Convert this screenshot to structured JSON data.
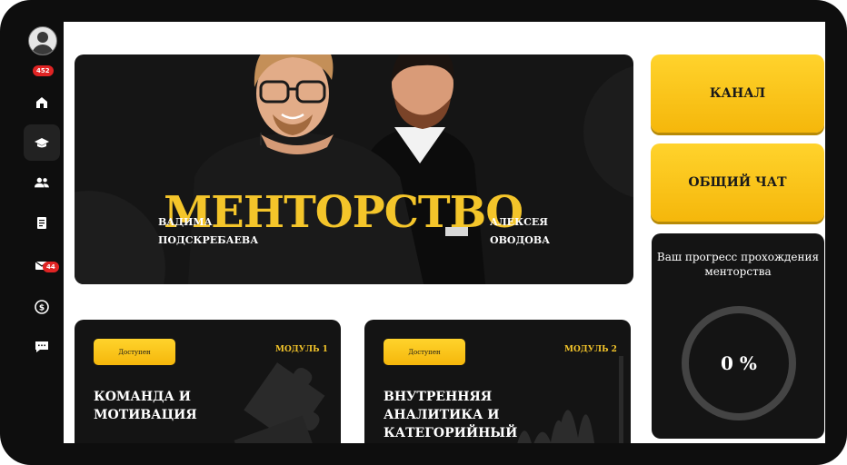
{
  "sidebar": {
    "profile_badge": "452",
    "mail_badge": "44",
    "items": [
      {
        "icon": "home-icon"
      },
      {
        "icon": "graduation-cap-icon"
      },
      {
        "icon": "users-icon"
      },
      {
        "icon": "document-icon"
      },
      {
        "icon": "mail-icon"
      },
      {
        "icon": "dollar-icon"
      },
      {
        "icon": "chat-icon"
      }
    ]
  },
  "hero": {
    "title": "МЕНТОРСТВО",
    "mentor_left": [
      "ВАДИМА",
      "ПОДСКРЕБАЕВА"
    ],
    "mentor_right": [
      "АЛЕКСЕЯ",
      "ОВОДОВА"
    ]
  },
  "actions": {
    "channel_label": "КАНАЛ",
    "chat_label": "ОБЩИЙ ЧАТ"
  },
  "progress": {
    "title": "Ваш прогресс прохождения менторства",
    "value_text": "0 %"
  },
  "modules": [
    {
      "status": "Доступен",
      "number": "МОДУЛЬ 1",
      "title": "КОМАНДА И МОТИВАЦИЯ"
    },
    {
      "status": "Доступен",
      "number": "МОДУЛЬ 2",
      "title": "ВНУТРЕННЯЯ АНАЛИТИКА И КАТЕГОРИЙНЫЙ"
    }
  ],
  "colors": {
    "accent": "#f4c52a",
    "background": "#0e0e0e",
    "badge": "#e02424"
  }
}
